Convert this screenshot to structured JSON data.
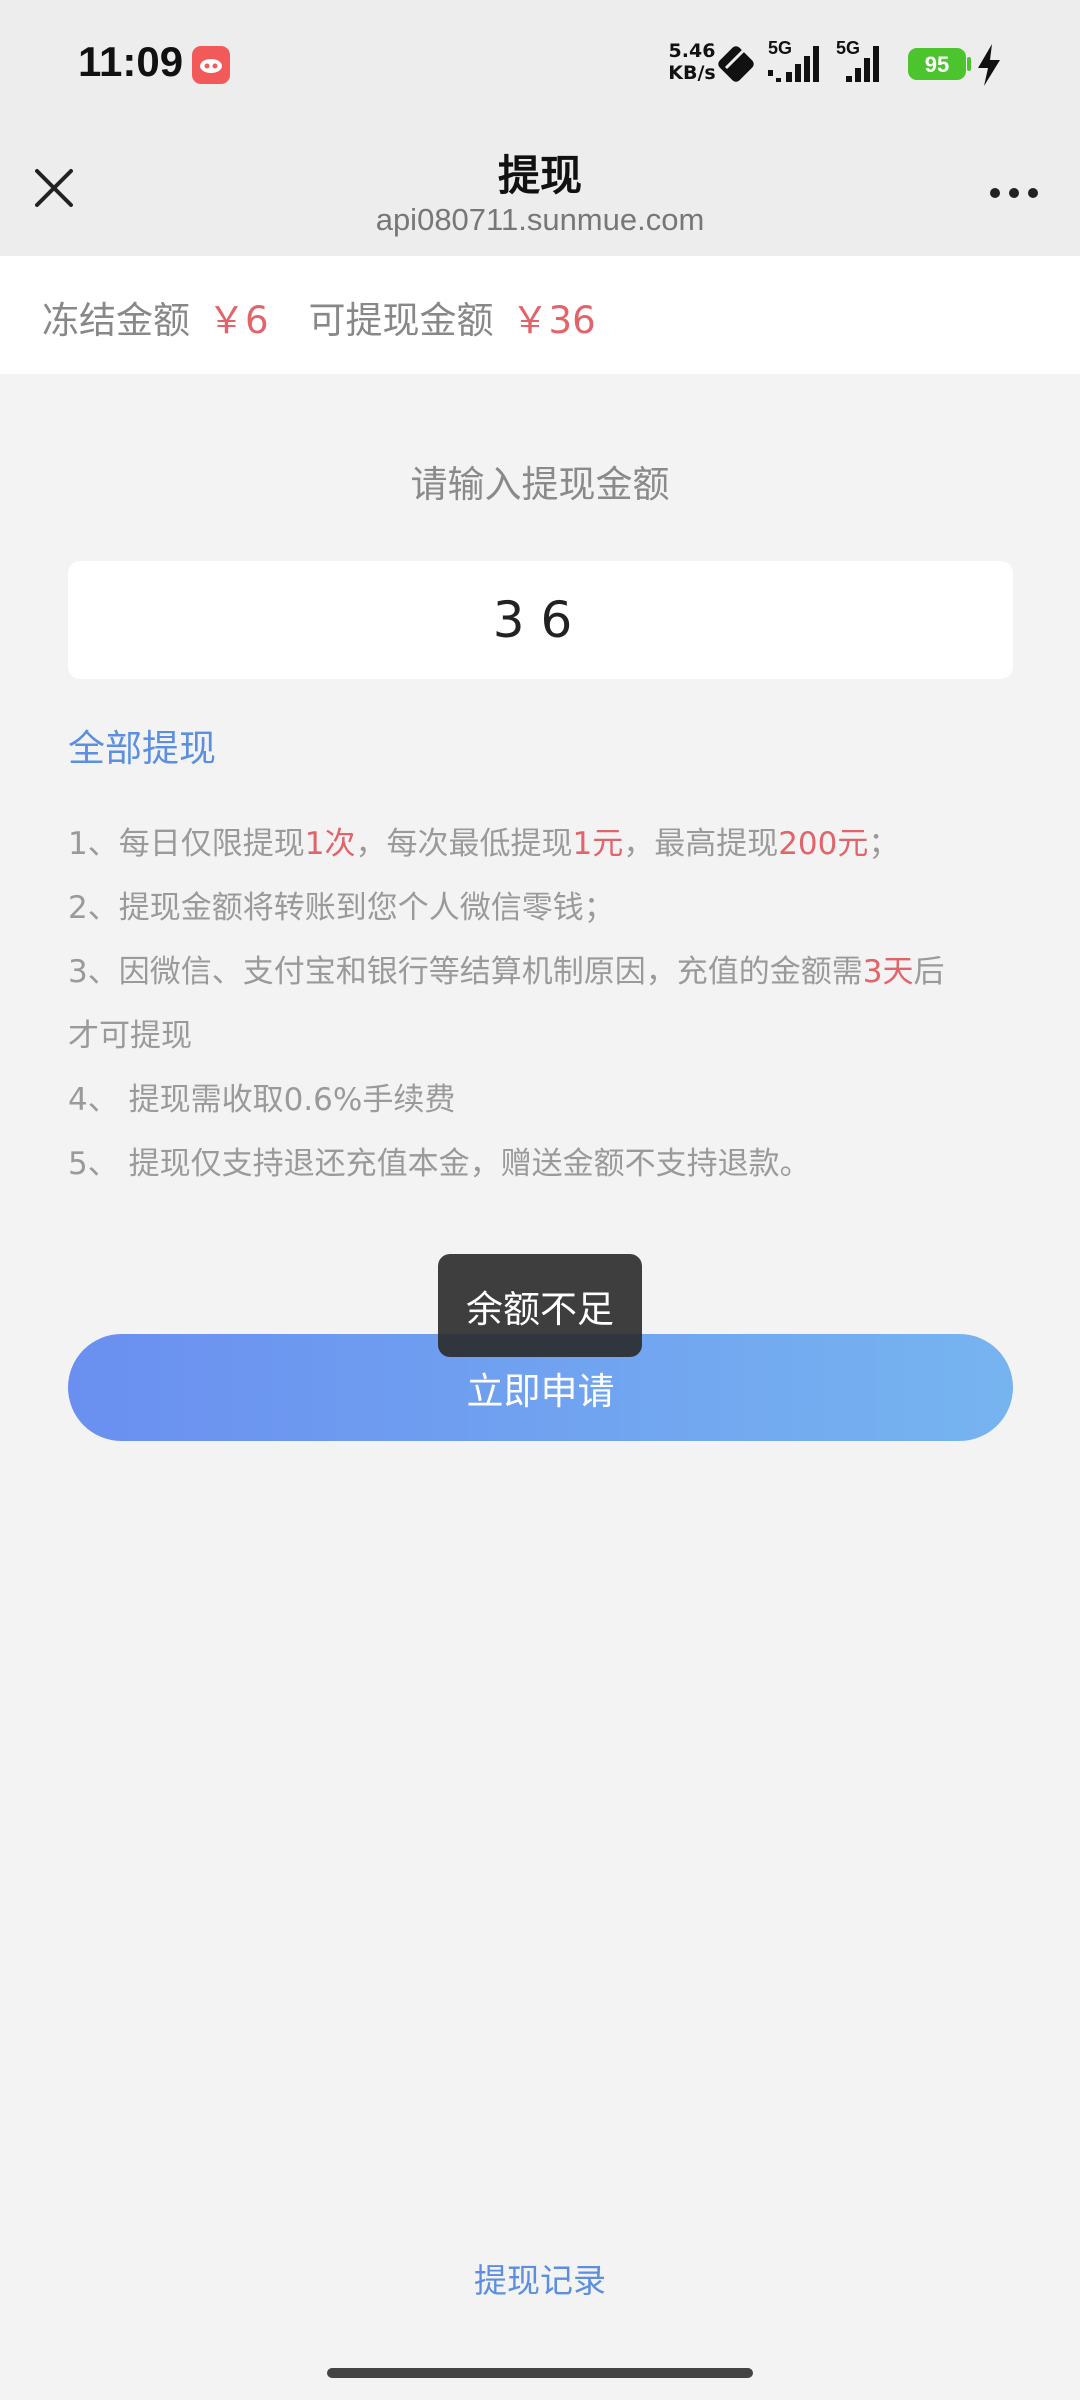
{
  "status_bar": {
    "time": "11:09",
    "net_speed_value": "5.46",
    "net_speed_unit": "KB/s",
    "sim1_label": "5G",
    "sim2_label": "5G",
    "battery": "95",
    "icons": [
      "app-notification-icon",
      "nfc-icon",
      "signal-icon",
      "battery-icon",
      "charging-icon"
    ]
  },
  "header": {
    "title": "提现",
    "url": "api080711.sunmue.com"
  },
  "balance": {
    "frozen_label": "冻结金额",
    "frozen_amount": "￥6",
    "available_label": "可提现金额",
    "available_amount": "￥36"
  },
  "form": {
    "prompt": "请输入提现金额",
    "amount_value": "36",
    "withdraw_all_label": "全部提现",
    "submit_label": "立即申请"
  },
  "rules": {
    "r1_a": "1、每日仅限提现",
    "r1_b": "1次",
    "r1_c": "，每次最低提现",
    "r1_d": "1元",
    "r1_e": "，最高提现",
    "r1_f": "200元",
    "r1_g": "；",
    "r2": "2、提现金额将转账到您个人微信零钱；",
    "r3_a": "3、因微信、支付宝和银行等结算机制原因，充值的金额需",
    "r3_b": "3天",
    "r3_c": "后",
    "r3_d": "才可提现",
    "r4": "4、 提现需收取0.6%手续费",
    "r5": "5、 提现仅支持退还充值本金，赠送金额不支持退款。"
  },
  "toast": "余额不足",
  "footer": {
    "records_link": "提现记录"
  },
  "colors": {
    "accent_blue": "#5d8fe0",
    "highlight_red": "#e0646a",
    "button_gradient_start": "#6a8ff0",
    "button_gradient_end": "#76b4f0",
    "battery_green": "#4cc42e"
  }
}
